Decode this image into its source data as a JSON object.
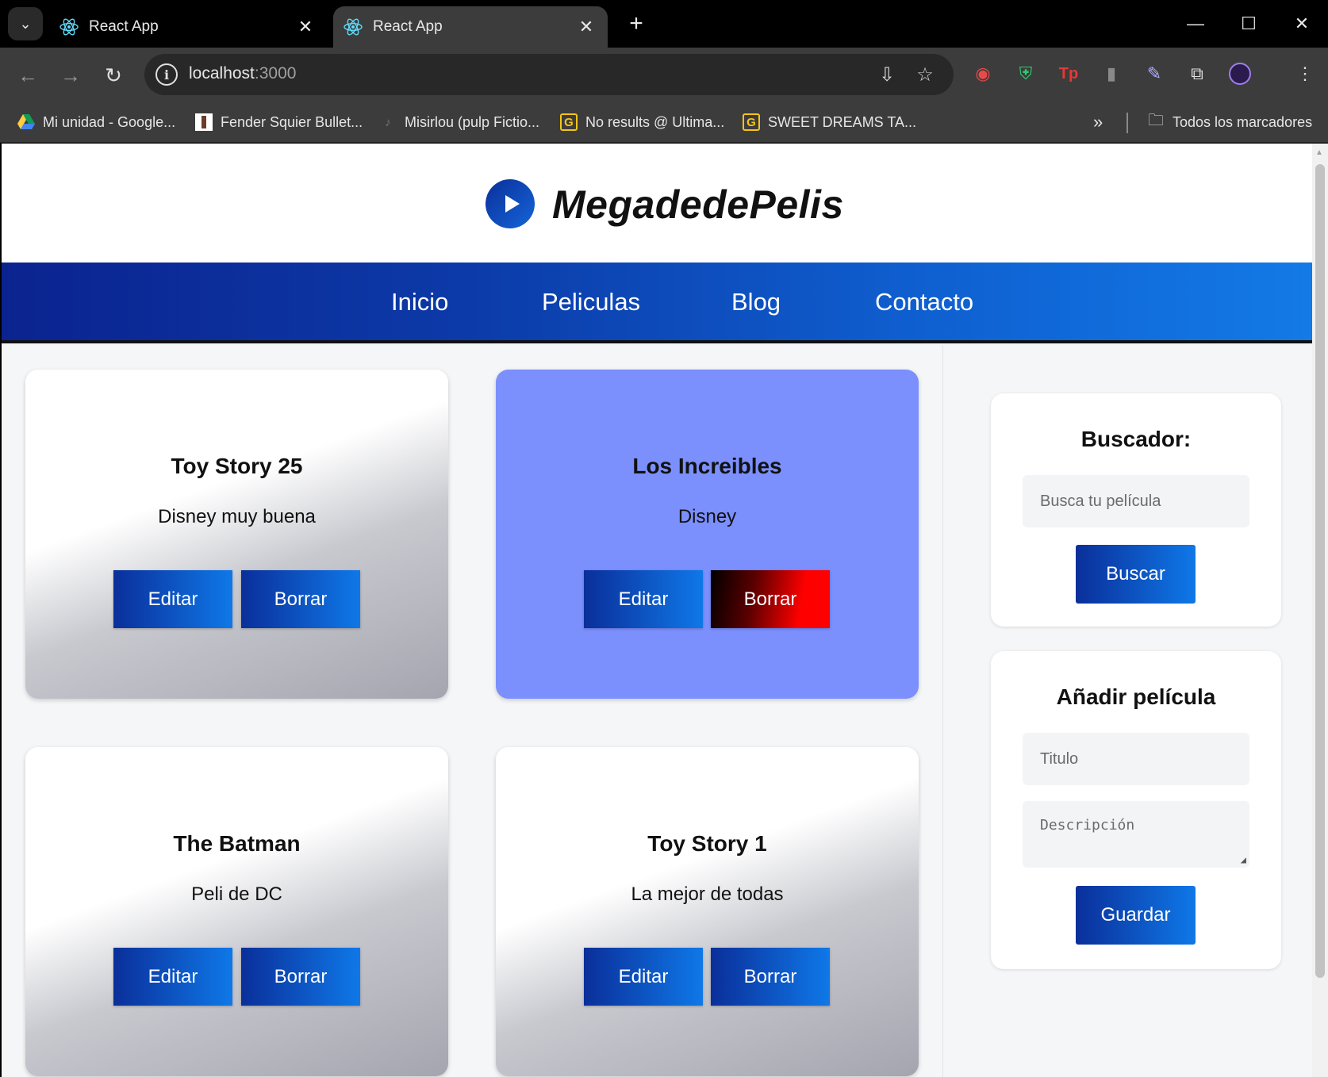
{
  "browser": {
    "tabs": [
      {
        "title": "React App"
      },
      {
        "title": "React App"
      }
    ],
    "url_host": "localhost",
    "url_port": ":3000",
    "bookmarks": [
      {
        "label": "Mi unidad - Google..."
      },
      {
        "label": "Fender Squier Bullet..."
      },
      {
        "label": "Misirlou (pulp Fictio..."
      },
      {
        "label": "No results @ Ultima..."
      },
      {
        "label": "SWEET DREAMS TA..."
      }
    ],
    "overflow": "»",
    "all_bookmarks": "Todos los marcadores"
  },
  "site": {
    "brand": "MegadedePelis",
    "nav": [
      "Inicio",
      "Peliculas",
      "Blog",
      "Contacto"
    ]
  },
  "movies": [
    {
      "title": "Toy Story 25",
      "description": "Disney muy buena",
      "edit": "Editar",
      "delete": "Borrar"
    },
    {
      "title": "Los Increibles",
      "description": "Disney",
      "edit": "Editar",
      "delete": "Borrar"
    },
    {
      "title": "The Batman",
      "description": "Peli de DC",
      "edit": "Editar",
      "delete": "Borrar"
    },
    {
      "title": "Toy Story 1",
      "description": "La mejor de todas",
      "edit": "Editar",
      "delete": "Borrar"
    }
  ],
  "search": {
    "heading": "Buscador:",
    "placeholder": "Busca tu película",
    "button": "Buscar"
  },
  "add": {
    "heading": "Añadir película",
    "title_placeholder": "Titulo",
    "desc_placeholder": "Descripción",
    "button": "Guardar"
  },
  "colors": {
    "nav_start": "#0b238f",
    "nav_end": "#137ae6",
    "highlight_card": "#7b8ffd",
    "delete_highlight": "#ff0000"
  }
}
